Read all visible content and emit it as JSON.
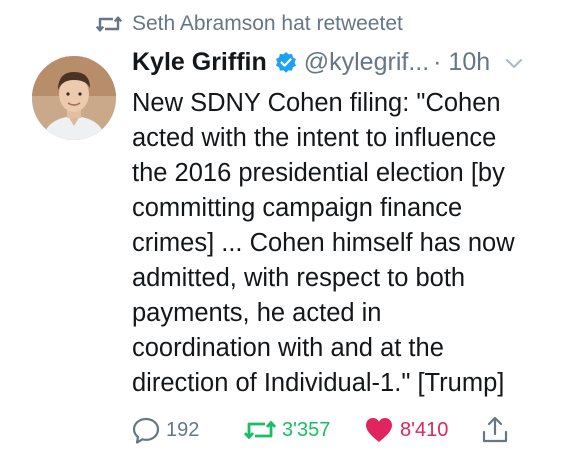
{
  "retweet_context": {
    "text": "Seth Abramson hat retweetet",
    "icon": "retweet-icon"
  },
  "author": {
    "display_name": "Kyle Griffin",
    "handle": "@kylegrif...",
    "time": "· 10h",
    "verified": true
  },
  "tweet": {
    "lines": [
      "New SDNY Cohen filing: \"Cohen",
      "acted with the intent to influence",
      "the 2016 presidential election [by",
      "committing campaign finance",
      "crimes] ... Cohen himself has now",
      "admitted, with respect to both",
      "payments, he acted in",
      "coordination with and at the",
      "direction of Individual-1.\" [Trump]"
    ]
  },
  "actions": {
    "replies": "192",
    "retweets": "3'357",
    "likes": "8'410"
  },
  "colors": {
    "text": "#14171a",
    "secondary": "#657786",
    "retweet_green": "#17bf63",
    "like_red": "#e0245e",
    "verified_blue": "#1da1f2"
  }
}
